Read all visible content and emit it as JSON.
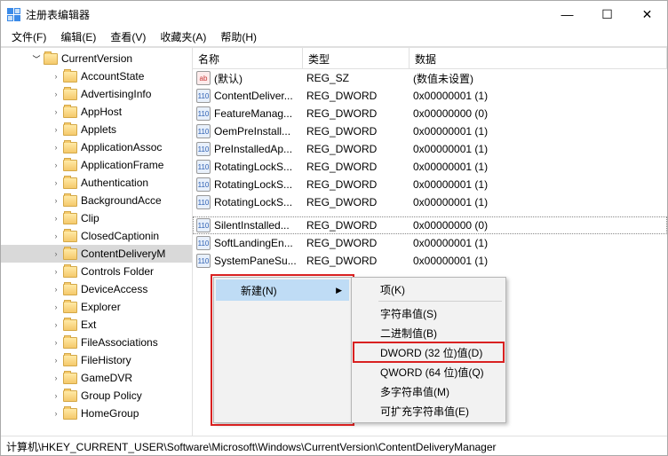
{
  "window": {
    "title": "注册表编辑器"
  },
  "menu": {
    "file": "文件(F)",
    "edit": "编辑(E)",
    "view": "查看(V)",
    "favorites": "收藏夹(A)",
    "help": "帮助(H)"
  },
  "tree": {
    "root": "CurrentVersion",
    "items": [
      "AccountState",
      "AdvertisingInfo",
      "AppHost",
      "Applets",
      "ApplicationAssoc",
      "ApplicationFrame",
      "Authentication",
      "BackgroundAcce",
      "Clip",
      "ClosedCaptionin",
      "ContentDeliveryM",
      "Controls Folder",
      "DeviceAccess",
      "Explorer",
      "Ext",
      "FileAssociations",
      "FileHistory",
      "GameDVR",
      "Group Policy",
      "HomeGroup"
    ],
    "selectedIndex": 10
  },
  "list": {
    "headers": {
      "name": "名称",
      "type": "类型",
      "data": "数据"
    },
    "rows": [
      {
        "icon": "sz",
        "name": "(默认)",
        "type": "REG_SZ",
        "data": "(数值未设置)"
      },
      {
        "icon": "dw",
        "name": "ContentDeliver...",
        "type": "REG_DWORD",
        "data": "0x00000001 (1)"
      },
      {
        "icon": "dw",
        "name": "FeatureManag...",
        "type": "REG_DWORD",
        "data": "0x00000000 (0)"
      },
      {
        "icon": "dw",
        "name": "OemPreInstall...",
        "type": "REG_DWORD",
        "data": "0x00000001 (1)"
      },
      {
        "icon": "dw",
        "name": "PreInstalledAp...",
        "type": "REG_DWORD",
        "data": "0x00000001 (1)"
      },
      {
        "icon": "dw",
        "name": "RotatingLockS...",
        "type": "REG_DWORD",
        "data": "0x00000001 (1)"
      },
      {
        "icon": "dw",
        "name": "RotatingLockS...",
        "type": "REG_DWORD",
        "data": "0x00000001 (1)"
      },
      {
        "icon": "dw",
        "name": "RotatingLockS...",
        "type": "REG_DWORD",
        "data": "0x00000001 (1)"
      },
      {
        "icon": "dw",
        "name": "SilentInstalled...",
        "type": "REG_DWORD",
        "data": "0x00000000 (0)",
        "selected": true
      },
      {
        "icon": "dw",
        "name": "SoftLandingEn...",
        "type": "REG_DWORD",
        "data": "0x00000001 (1)"
      },
      {
        "icon": "dw",
        "name": "SystemPaneSu...",
        "type": "REG_DWORD",
        "data": "0x00000001 (1)"
      }
    ]
  },
  "context": {
    "new": "新建(N)",
    "sub": {
      "key": "项(K)",
      "string": "字符串值(S)",
      "binary": "二进制值(B)",
      "dword": "DWORD (32 位)值(D)",
      "qword": "QWORD (64 位)值(Q)",
      "multi": "多字符串值(M)",
      "expand": "可扩充字符串值(E)"
    }
  },
  "statusbar": "计算机\\HKEY_CURRENT_USER\\Software\\Microsoft\\Windows\\CurrentVersion\\ContentDeliveryManager"
}
